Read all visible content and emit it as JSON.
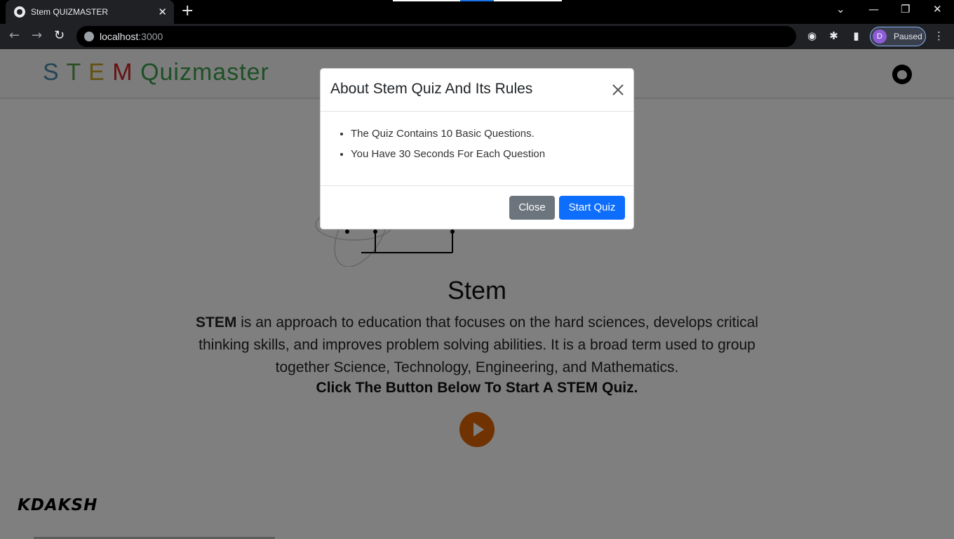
{
  "browser": {
    "tab_title": "Stem QUIZMASTER",
    "tab_close": "✕",
    "new_tab": "+",
    "url_host": "localhost",
    "url_port": ":3000",
    "profile_initial": "D",
    "profile_status": "Paused",
    "win_ctl": {
      "tabs_menu": "⌄",
      "minimize": "—",
      "restore": "❐",
      "close": "✕"
    },
    "nav": {
      "back": "←",
      "forward": "→",
      "reload": "↻"
    },
    "toolbar_icons": {
      "extensions": "✱",
      "sidepanel": "▮",
      "menu": "⋮",
      "media": "◉"
    }
  },
  "site": {
    "brand": {
      "letters": [
        "S",
        "T",
        "E",
        "M"
      ],
      "rest": "Quizmaster"
    },
    "colors": {
      "s": "#4a8aa8",
      "t": "#5c9e4a",
      "e": "#c9a227",
      "m": "#cc2222",
      "quiz": "#4a8aa8",
      "master": "#3da14a"
    },
    "hero_title": "Stem",
    "hero_bold": "STEM",
    "hero_text": " is an approach to education that focuses on the hard sciences, develops critical thinking skills, and improves problem solving abilities. It is a broad term used to group together Science, Technology, Engineering, and Mathematics.",
    "hero_cta": "Click The Button Below To Start A STEM Quiz.",
    "signature": "KDAKSH"
  },
  "modal": {
    "title": "About Stem Quiz And Its Rules",
    "rules": [
      "The Quiz Contains 10 Basic Questions.",
      "You Have 30 Seconds For Each Question"
    ],
    "close_label": "Close",
    "start_label": "Start Quiz"
  }
}
